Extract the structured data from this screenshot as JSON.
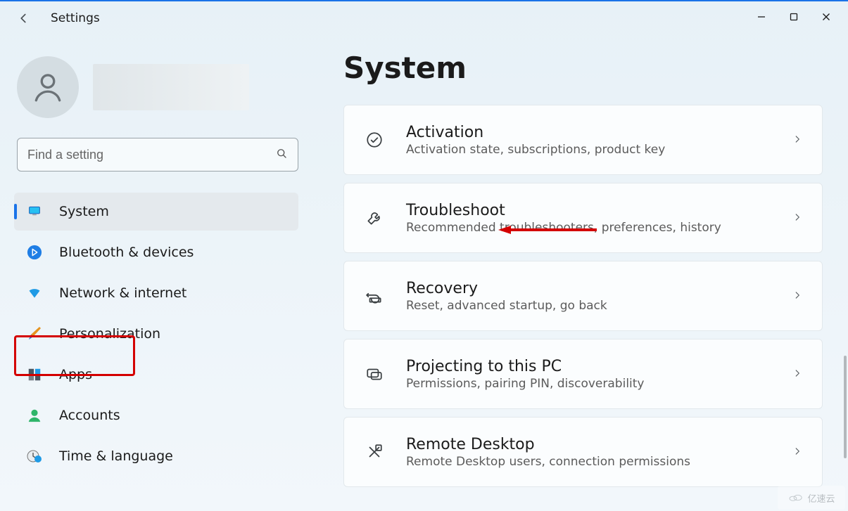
{
  "app_title": "Settings",
  "search_placeholder": "Find a setting",
  "page_heading": "System",
  "sidebar": {
    "items": [
      {
        "label": "System",
        "icon": "monitor",
        "selected": true
      },
      {
        "label": "Bluetooth & devices",
        "icon": "bluetooth",
        "selected": false
      },
      {
        "label": "Network & internet",
        "icon": "wifi",
        "selected": false
      },
      {
        "label": "Personalization",
        "icon": "brush",
        "selected": false
      },
      {
        "label": "Apps",
        "icon": "apps",
        "selected": false
      },
      {
        "label": "Accounts",
        "icon": "person",
        "selected": false
      },
      {
        "label": "Time & language",
        "icon": "clock-globe",
        "selected": false
      }
    ]
  },
  "cards": [
    {
      "title": "Activation",
      "desc": "Activation state, subscriptions, product key",
      "icon": "check-circle"
    },
    {
      "title": "Troubleshoot",
      "desc": "Recommended troubleshooters, preferences, history",
      "icon": "wrench"
    },
    {
      "title": "Recovery",
      "desc": "Reset, advanced startup, go back",
      "icon": "recovery"
    },
    {
      "title": "Projecting to this PC",
      "desc": "Permissions, pairing PIN, discoverability",
      "icon": "project"
    },
    {
      "title": "Remote Desktop",
      "desc": "Remote Desktop users, connection permissions",
      "icon": "remote"
    }
  ],
  "watermark_text": "亿速云",
  "annotations": {
    "highlighted_sidebar_item": "System",
    "arrow_points_to_card": "Troubleshoot"
  }
}
